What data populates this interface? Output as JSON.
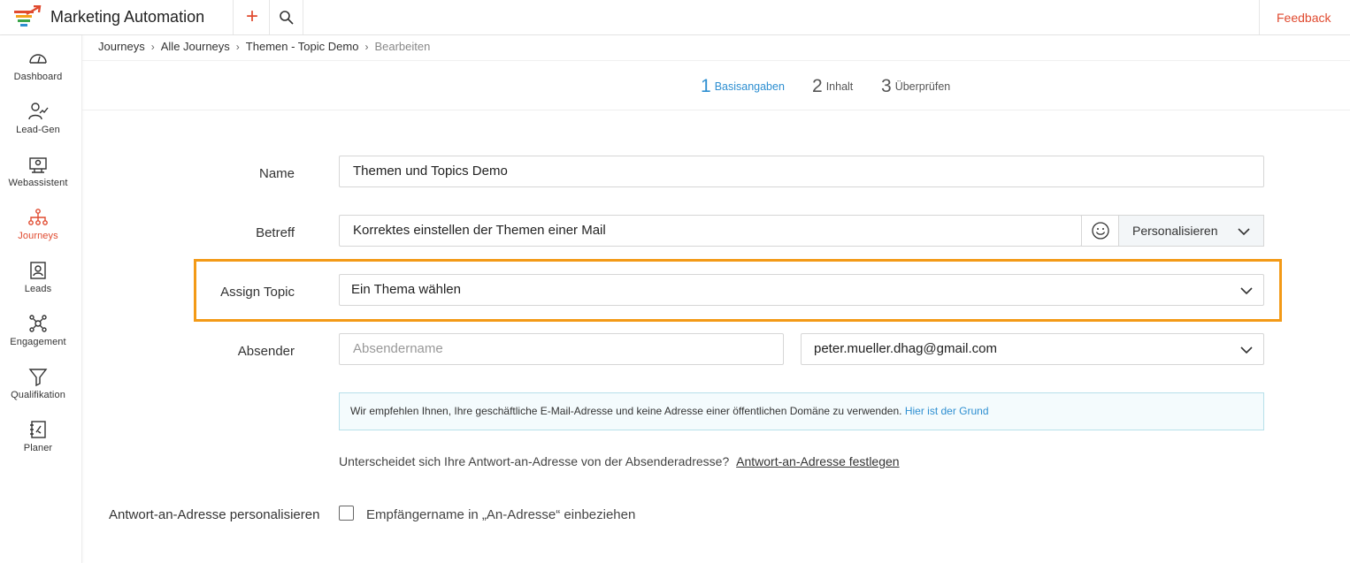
{
  "topbar": {
    "app_title": "Marketing Automation",
    "feedback_label": "Feedback"
  },
  "sidebar": {
    "items": [
      {
        "label": "Dashboard",
        "icon": "dashboard-gauge-icon"
      },
      {
        "label": "Lead-Gen",
        "icon": "lead-gen-icon"
      },
      {
        "label": "Webassistent",
        "icon": "webassistant-icon"
      },
      {
        "label": "Journeys",
        "icon": "journeys-icon",
        "active": true
      },
      {
        "label": "Leads",
        "icon": "leads-contact-icon"
      },
      {
        "label": "Engagement",
        "icon": "engagement-icon"
      },
      {
        "label": "Qualifikation",
        "icon": "funnel-icon"
      },
      {
        "label": "Planer",
        "icon": "planner-icon"
      }
    ]
  },
  "breadcrumb": [
    "Journeys",
    "Alle Journeys",
    "Themen - Topic Demo",
    "Bearbeiten"
  ],
  "steps": [
    {
      "number": "1",
      "label": "Basisangaben",
      "active": true
    },
    {
      "number": "2",
      "label": "Inhalt"
    },
    {
      "number": "3",
      "label": "Überprüfen"
    }
  ],
  "form": {
    "name_label": "Name",
    "name_value": "Themen und Topics Demo",
    "subject_label": "Betreff",
    "subject_value": "Korrektes einstellen der Themen einer Mail",
    "personalize_label": "Personalisieren",
    "topic_label": "Assign Topic",
    "topic_value": "Ein Thema wählen",
    "sender_label": "Absender",
    "sender_name_placeholder": "Absendername",
    "sender_email_value": "peter.mueller.dhag@gmail.com",
    "notice_text": "Wir empfehlen Ihnen, Ihre geschäftliche E-Mail-Adresse und keine Adresse einer öffentlichen Domäne zu verwenden.",
    "notice_link": "Hier ist der Grund",
    "reply_question": "Unterscheidet sich Ihre Antwort-an-Adresse von der Absenderadresse?",
    "reply_link": "Antwort-an-Adresse festlegen",
    "personalize_reply_label": "Antwort-an-Adresse personalisieren",
    "include_name_label": "Empfängername in „An-Adresse“ einbeziehen",
    "include_name_checked": false
  },
  "colors": {
    "accent": "#e04a2f",
    "active_step": "#2e8fd1",
    "highlight": "#f39a17"
  }
}
